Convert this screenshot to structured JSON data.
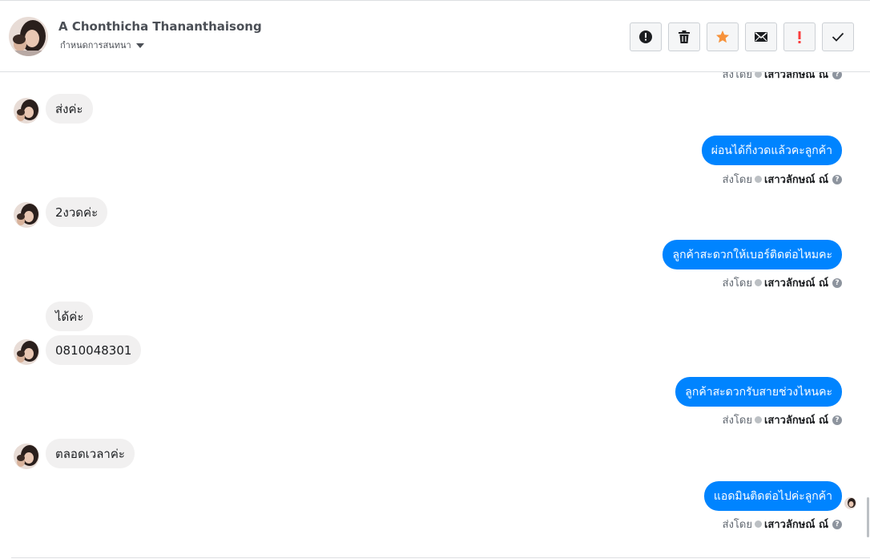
{
  "header": {
    "contact_name": "A Chonthicha Thananthaisong",
    "conversation_settings": "กำหนดการสนทนา"
  },
  "toolbar": [
    {
      "name": "alert-button",
      "icon": "exclamation-circle-icon"
    },
    {
      "name": "delete-button",
      "icon": "trash-icon"
    },
    {
      "name": "star-button",
      "icon": "star-icon",
      "color": "#f7923a"
    },
    {
      "name": "mail-button",
      "icon": "envelope-icon"
    },
    {
      "name": "spam-button",
      "icon": "exclamation-icon",
      "color": "#fa3e3e"
    },
    {
      "name": "done-button",
      "icon": "check-icon"
    }
  ],
  "messages": {
    "m1": "ส่งค่ะ",
    "m2": "ผ่อนได้กี่งวดแล้วคะลูกค้า",
    "m3": "2งวดค่ะ",
    "m4": "ลูกค้าสะดวกให้เบอร์ติดต่อไหมคะ",
    "m5": "ได้ค่ะ",
    "m6": "0810048301",
    "m7": "ลูกค้าสะดวกรับสายช่วงไหนคะ",
    "m8": "ตลอดเวลาค่ะ",
    "m9": "แอดมินติดต่อไปค่ะลูกค้า"
  },
  "sent_by": {
    "label": "ส่งโดย",
    "agent": "เสาวลักษณ์ ณ์",
    "help": "?"
  },
  "colors": {
    "outgoing_bubble": "#0084ff",
    "incoming_bubble": "#f1f0f0"
  }
}
